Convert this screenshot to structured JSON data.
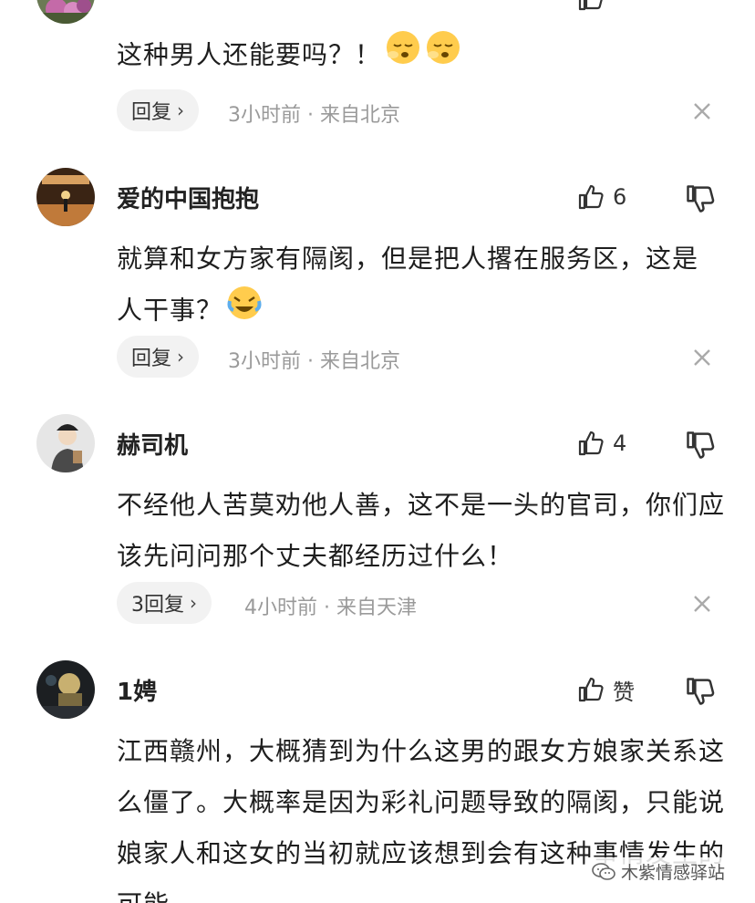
{
  "comments": [
    {
      "username": "",
      "like_count": "",
      "text": "这种男人还能要吗？！",
      "reply_label": "回复",
      "meta": "3小时前 · 来自北京"
    },
    {
      "username": "爱的中国抱抱",
      "like_count": "6",
      "text": "就算和女方家有隔阂，但是把人撂在服务区，这是人干事？",
      "reply_label": "回复",
      "meta": "3小时前 · 来自北京"
    },
    {
      "username": "赫司机",
      "like_count": "4",
      "text": "不经他人苦莫劝他人善，这不是一头的官司，你们应该先问问那个丈夫都经历过什么！",
      "reply_label": "3回复",
      "meta": "4小时前 · 来自天津"
    },
    {
      "username": "1娉",
      "like_count": "赞",
      "text": "江西赣州，大概猜到为什么这男的跟女方娘家关系这么僵了。大概率是因为彩礼问题导致的隔阂，只能说娘家人和这女的当初就应该想到会有这种事情发生的可能",
      "reply_label": "",
      "meta": ""
    }
  ],
  "watermark": "木紫情感驿站",
  "icons": {
    "like": "thumbs-up-icon",
    "dislike": "thumbs-down-icon",
    "close": "close-icon",
    "chevron": "chevron-right-icon"
  }
}
